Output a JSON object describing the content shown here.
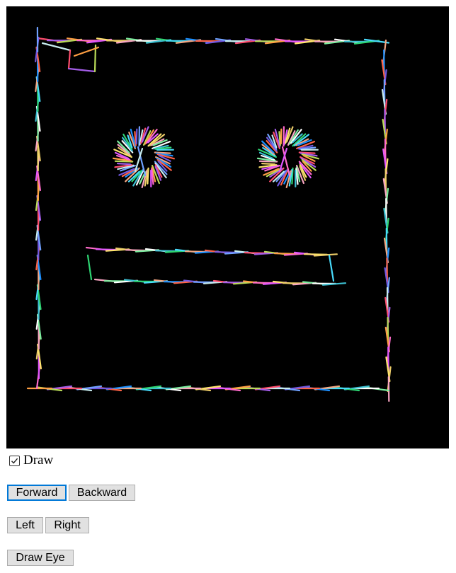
{
  "controls": {
    "draw_label": "Draw",
    "draw_checked": true,
    "forward_label": "Forward",
    "backward_label": "Backward",
    "left_label": "Left",
    "right_label": "Right",
    "draw_eye_label": "Draw Eye"
  },
  "canvas": {
    "background": "#000000",
    "stroke_palette": [
      "#ff4d6d",
      "#ff9f43",
      "#ffe66d",
      "#7bed9f",
      "#2ed573",
      "#1e90ff",
      "#70a1ff",
      "#a55eea",
      "#ff6bcb",
      "#eccc68",
      "#ffffff",
      "#48dbfb",
      "#ff6348",
      "#c7ecee",
      "#badc58",
      "#e056fd",
      "#f8a5c2",
      "#3dc1d3",
      "#f3a683",
      "#7158e2"
    ]
  }
}
